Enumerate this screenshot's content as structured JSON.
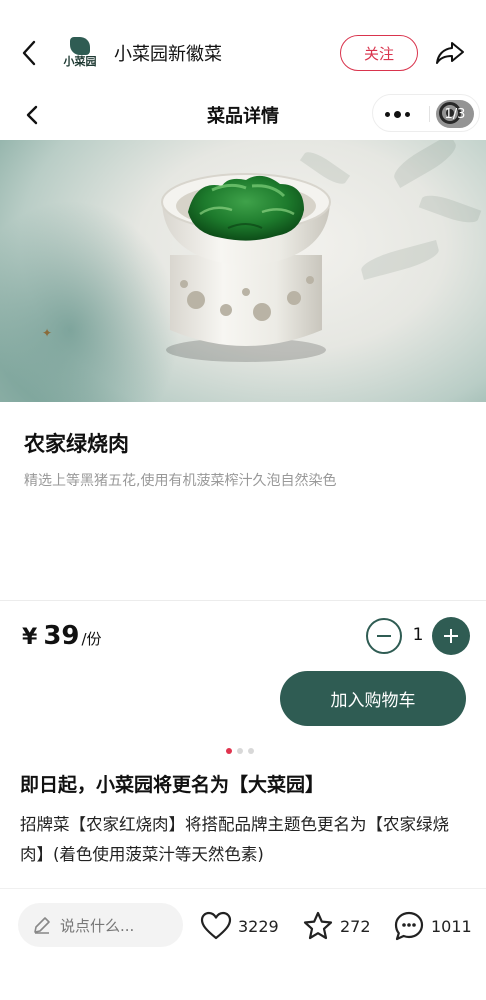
{
  "header": {
    "brand_name": "小菜园新徽菜",
    "logo_text": "小菜园",
    "follow_label": "关注"
  },
  "nav": {
    "title": "菜品详情",
    "page_indicator": "1/3"
  },
  "dish": {
    "name": "农家绿烧肉",
    "description": "精选上等黑猪五花,使用有机菠菜榨汁久泡自然染色",
    "currency": "¥",
    "price": "39",
    "unit": "/份",
    "quantity": "1",
    "add_to_cart_label": "加入购物车"
  },
  "carousel": {
    "count": 3,
    "active_index": 0
  },
  "post": {
    "title": "即日起，小菜园将更名为【大菜园】",
    "body": "招牌菜【农家红烧肉】将搭配品牌主题色更名为【农家绿烧肉】(着色使用菠菜汁等天然色素)"
  },
  "bottom_bar": {
    "comment_placeholder": "说点什么...",
    "likes": "3229",
    "favorites": "272",
    "comments": "1011"
  },
  "colors": {
    "accent_green": "#2f5c53",
    "follow_red": "#d9344d",
    "dot_active": "#e0344e"
  },
  "icons": [
    "back-arrow-icon",
    "share-icon",
    "more-dots-icon",
    "target-icon",
    "minus-icon",
    "plus-icon",
    "pencil-icon",
    "heart-icon",
    "star-icon",
    "comment-bubble-icon"
  ]
}
